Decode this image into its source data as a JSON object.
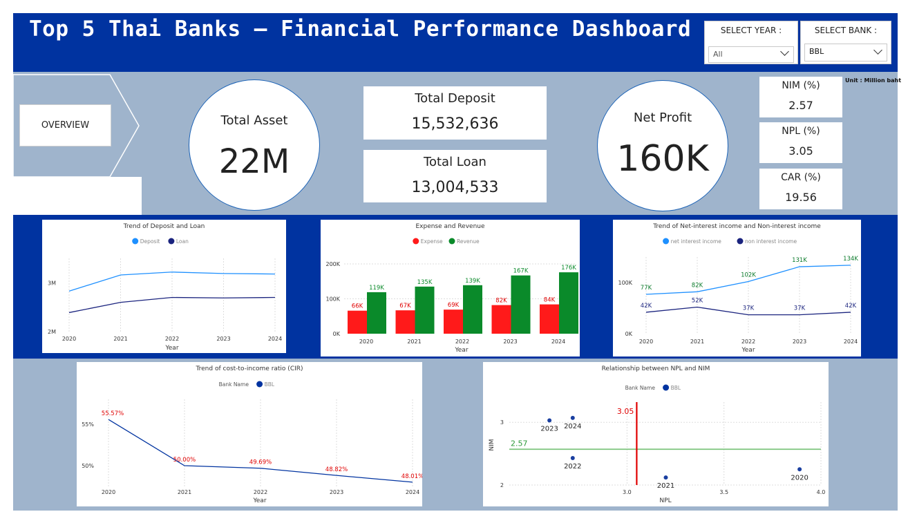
{
  "header": {
    "title": "Top 5 Thai Banks – Financial Performance Dashboard"
  },
  "filters": {
    "year": {
      "label": "SELECT YEAR :",
      "value": "All"
    },
    "bank": {
      "label": "SELECT BANK :",
      "value": "BBL"
    }
  },
  "nav": {
    "overview_label": "OVERVIEW"
  },
  "kpis": {
    "total_asset": {
      "label": "Total Asset",
      "value": "22M"
    },
    "total_deposit": {
      "label": "Total Deposit",
      "value": "15,532,636"
    },
    "total_loan": {
      "label": "Total Loan",
      "value": "13,004,533"
    },
    "net_profit": {
      "label": "Net Profit",
      "value": "160K"
    },
    "nim": {
      "label": "NIM (%)",
      "value": "2.57"
    },
    "npl": {
      "label": "NPL (%)",
      "value": "3.05"
    },
    "car": {
      "label": "CAR (%)",
      "value": "19.56"
    },
    "unit": "Unit : Million baht"
  },
  "colors": {
    "header": "#0033a0",
    "band": "#9fb4cc",
    "light_blue": "#1e90ff",
    "navy": "#1a237e",
    "expense": "#ff1a1a",
    "revenue": "#0a8a2a",
    "red_label": "#e00000",
    "green_line": "#7cc47c"
  },
  "chart_data": [
    {
      "id": "deposit_loan",
      "type": "line",
      "title": "Trend of Deposit and Loan",
      "xlabel": "Year",
      "ylabel": "",
      "x": [
        "2020",
        "2021",
        "2022",
        "2023",
        "2024"
      ],
      "series": [
        {
          "name": "Deposit",
          "values": [
            2.83,
            3.16,
            3.22,
            3.19,
            3.18
          ]
        },
        {
          "name": "Loan",
          "values": [
            2.39,
            2.6,
            2.7,
            2.69,
            2.7
          ]
        }
      ],
      "yticks": [
        {
          "v": 2,
          "label": "2M"
        },
        {
          "v": 3,
          "label": "3M"
        }
      ],
      "ylim": [
        2,
        3.5
      ],
      "legend": "top-center"
    },
    {
      "id": "expense_revenue",
      "type": "bar",
      "title": "Expense and Revenue",
      "xlabel": "Year",
      "ylabel": "",
      "categories": [
        "2020",
        "2021",
        "2022",
        "2023",
        "2024"
      ],
      "series": [
        {
          "name": "Expense",
          "values": [
            66,
            67,
            69,
            82,
            84
          ],
          "labels": [
            "66K",
            "67K",
            "69K",
            "82K",
            "84K"
          ]
        },
        {
          "name": "Revenue",
          "values": [
            119,
            135,
            139,
            167,
            176
          ],
          "labels": [
            "119K",
            "135K",
            "139K",
            "167K",
            "176K"
          ]
        }
      ],
      "yticks": [
        {
          "v": 0,
          "label": "0K"
        },
        {
          "v": 100,
          "label": "100K"
        },
        {
          "v": 200,
          "label": "200K"
        }
      ],
      "ylim": [
        0,
        200
      ],
      "legend": "top-center"
    },
    {
      "id": "nii",
      "type": "line",
      "title": "Trend of Net-interest income and Non-interest income",
      "xlabel": "Year",
      "ylabel": "",
      "x": [
        "2020",
        "2021",
        "2022",
        "2023",
        "2024"
      ],
      "series": [
        {
          "name": "net interest income",
          "values": [
            77,
            82,
            102,
            131,
            134
          ],
          "labels": [
            "77K",
            "82K",
            "102K",
            "131K",
            "134K"
          ]
        },
        {
          "name": "non interest income",
          "values": [
            42,
            52,
            37,
            37,
            42
          ],
          "labels": [
            "42K",
            "52K",
            "37K",
            "37K",
            "42K"
          ]
        }
      ],
      "yticks": [
        {
          "v": 0,
          "label": "0K"
        },
        {
          "v": 100,
          "label": "100K"
        }
      ],
      "ylim": [
        0,
        150
      ],
      "legend": "top-center"
    },
    {
      "id": "cir",
      "type": "line",
      "title": "Trend of cost-to-income ratio (CIR)",
      "xlabel": "Year",
      "ylabel": "",
      "legend_title": "Bank Name",
      "x": [
        "2020",
        "2021",
        "2022",
        "2023",
        "2024"
      ],
      "series": [
        {
          "name": "BBL",
          "values": [
            55.57,
            50.0,
            49.69,
            48.82,
            48.01
          ],
          "labels": [
            "55.57%",
            "50.00%",
            "49.69%",
            "48.82%",
            "48.01%"
          ]
        }
      ],
      "yticks": [
        {
          "v": 50,
          "label": "50%"
        },
        {
          "v": 55,
          "label": "55%"
        }
      ],
      "ylim": [
        47.5,
        58
      ],
      "legend": "top-center"
    },
    {
      "id": "npl_nim",
      "type": "scatter",
      "title": "Relationship between NPL and NIM",
      "xlabel": "NPL",
      "ylabel": "NIM",
      "legend_title": "Bank Name",
      "series": [
        {
          "name": "BBL",
          "points": [
            {
              "x": 3.89,
              "y": 2.25,
              "label": "2020"
            },
            {
              "x": 3.2,
              "y": 2.12,
              "label": "2021"
            },
            {
              "x": 2.72,
              "y": 2.43,
              "label": "2022"
            },
            {
              "x": 2.6,
              "y": 3.03,
              "label": "2023"
            },
            {
              "x": 2.72,
              "y": 3.07,
              "label": "2024"
            }
          ]
        }
      ],
      "ref_lines": {
        "x": 3.05,
        "x_label": "3.05",
        "y": 2.57,
        "y_label": "2.57"
      },
      "xticks": [
        {
          "v": 3.0,
          "label": "3.0"
        },
        {
          "v": 3.5,
          "label": "3.5"
        },
        {
          "v": 4.0,
          "label": "4.0"
        }
      ],
      "yticks": [
        {
          "v": 2,
          "label": "2"
        },
        {
          "v": 3,
          "label": "3"
        }
      ],
      "xlim": [
        2.4,
        4.0
      ],
      "ylim": [
        2,
        3.3
      ],
      "legend": "top-center"
    }
  ]
}
